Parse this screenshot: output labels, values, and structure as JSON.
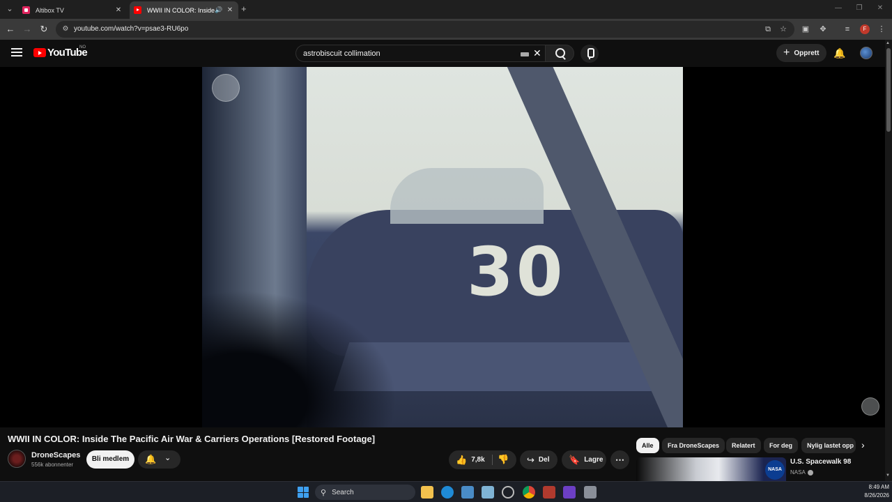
{
  "browser": {
    "tabs": [
      {
        "title": "Altibox TV"
      },
      {
        "title": "WWII IN COLOR: Inside The Pacific Air War & Carriers Operations [Restored Footage]"
      }
    ],
    "url": "youtube.com/watch?v=psae3-RU6po"
  },
  "youtube": {
    "logo_text": "YouTube",
    "country_code": "NO",
    "search_value": "astrobiscuit collimation",
    "create_label": "Opprett"
  },
  "video": {
    "frame_number": "30",
    "title": "WWII IN COLOR: Inside The Pacific Air War & Carriers Operations [Restored Footage]",
    "channel_name": "DroneScapes",
    "subscribers": "556k abonnenter",
    "join_label": "Bli medlem",
    "likes": "7,8k",
    "share_label": "Del",
    "save_label": "Lagre"
  },
  "chips": [
    "Alle",
    "Fra DroneScapes",
    "Relatert",
    "For deg",
    "Nylig lastet opp"
  ],
  "related": [
    {
      "title": "U.S. Spacewalk 98",
      "channel": "NASA",
      "badge": "NASA"
    }
  ],
  "taskbar": {
    "search_label": "Search",
    "time": "8:49 AM",
    "date": "8/26/2026"
  }
}
